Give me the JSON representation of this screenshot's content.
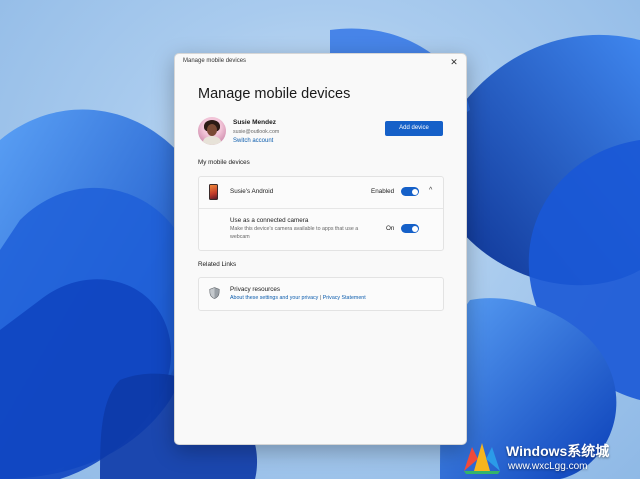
{
  "dialog": {
    "window_title": "Manage mobile devices",
    "heading": "Manage mobile devices",
    "close_glyph": "✕"
  },
  "account": {
    "name": "Susie Mendez",
    "email": "susie@outlook.com",
    "switch_label": "Switch account",
    "add_device_label": "Add device"
  },
  "my_devices": {
    "section_label": "My mobile devices",
    "device": {
      "name": "Susie's Android",
      "status": "Enabled",
      "toggle_on": true,
      "expanded": true,
      "chevron_glyph": "^"
    },
    "camera": {
      "title": "Use as a connected camera",
      "description": "Make this device's camera available to apps that use a webcam",
      "status": "On",
      "toggle_on": true
    }
  },
  "related_links": {
    "section_label": "Related Links",
    "privacy": {
      "title": "Privacy resources",
      "link1": "About these settings and your privacy",
      "separator": "|",
      "link2": "Privacy Statement"
    }
  },
  "watermark": {
    "title": "Windows系统城",
    "url": "www.wxcLgg.com"
  },
  "colors": {
    "accent": "#1560c8",
    "link": "#0b5cad"
  }
}
